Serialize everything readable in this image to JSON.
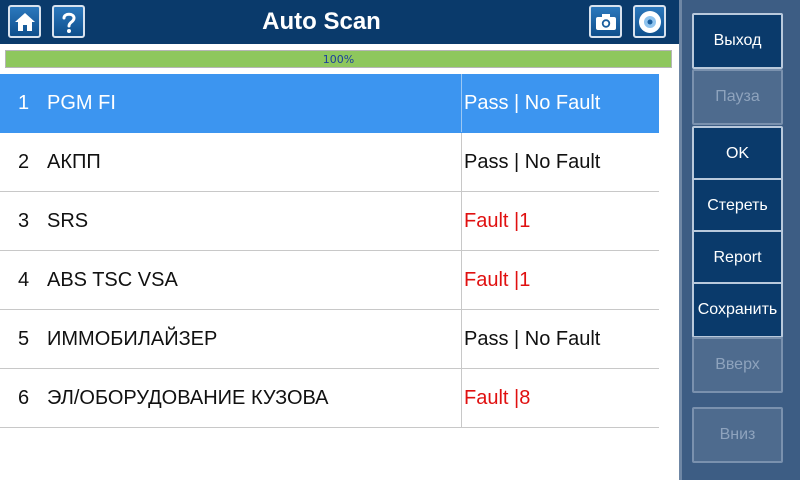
{
  "header": {
    "title": "Auto Scan"
  },
  "progress": {
    "label": "100%",
    "value": 1.0
  },
  "rows": [
    {
      "num": "1",
      "name": "PGM FI",
      "status": "Pass | No Fault",
      "fault": false,
      "selected": true
    },
    {
      "num": "2",
      "name": "АКПП",
      "status": "Pass | No Fault",
      "fault": false,
      "selected": false
    },
    {
      "num": "3",
      "name": "SRS",
      "status": "Fault |1",
      "fault": true,
      "selected": false
    },
    {
      "num": "4",
      "name": "ABS TSC VSA",
      "status": "Fault |1",
      "fault": true,
      "selected": false
    },
    {
      "num": "5",
      "name": "ИММОБИЛАЙЗЕР",
      "status": "Pass | No Fault",
      "fault": false,
      "selected": false
    },
    {
      "num": "6",
      "name": "ЭЛ/ОБОРУДОВАНИЕ КУЗОВА",
      "status": "Fault |8",
      "fault": true,
      "selected": false
    }
  ],
  "sidebar": {
    "exit_label": "Выход",
    "pause_label": "Пауза",
    "ok_label": "OK",
    "erase_label": "Стереть",
    "report_label": "Report",
    "save_label": "Сохранить",
    "up_label": "Вверх",
    "down_label": "Вниз"
  },
  "icons": {
    "home": "home-icon",
    "help": "help-icon",
    "camera": "camera-icon",
    "disc": "disc-icon"
  },
  "colors": {
    "header_bg": "#0a3a6b",
    "selected_row": "#3c95f0",
    "fault_text": "#e01010",
    "progress_fill": "#8ec75d",
    "panel_bg": "#3d5d84"
  }
}
